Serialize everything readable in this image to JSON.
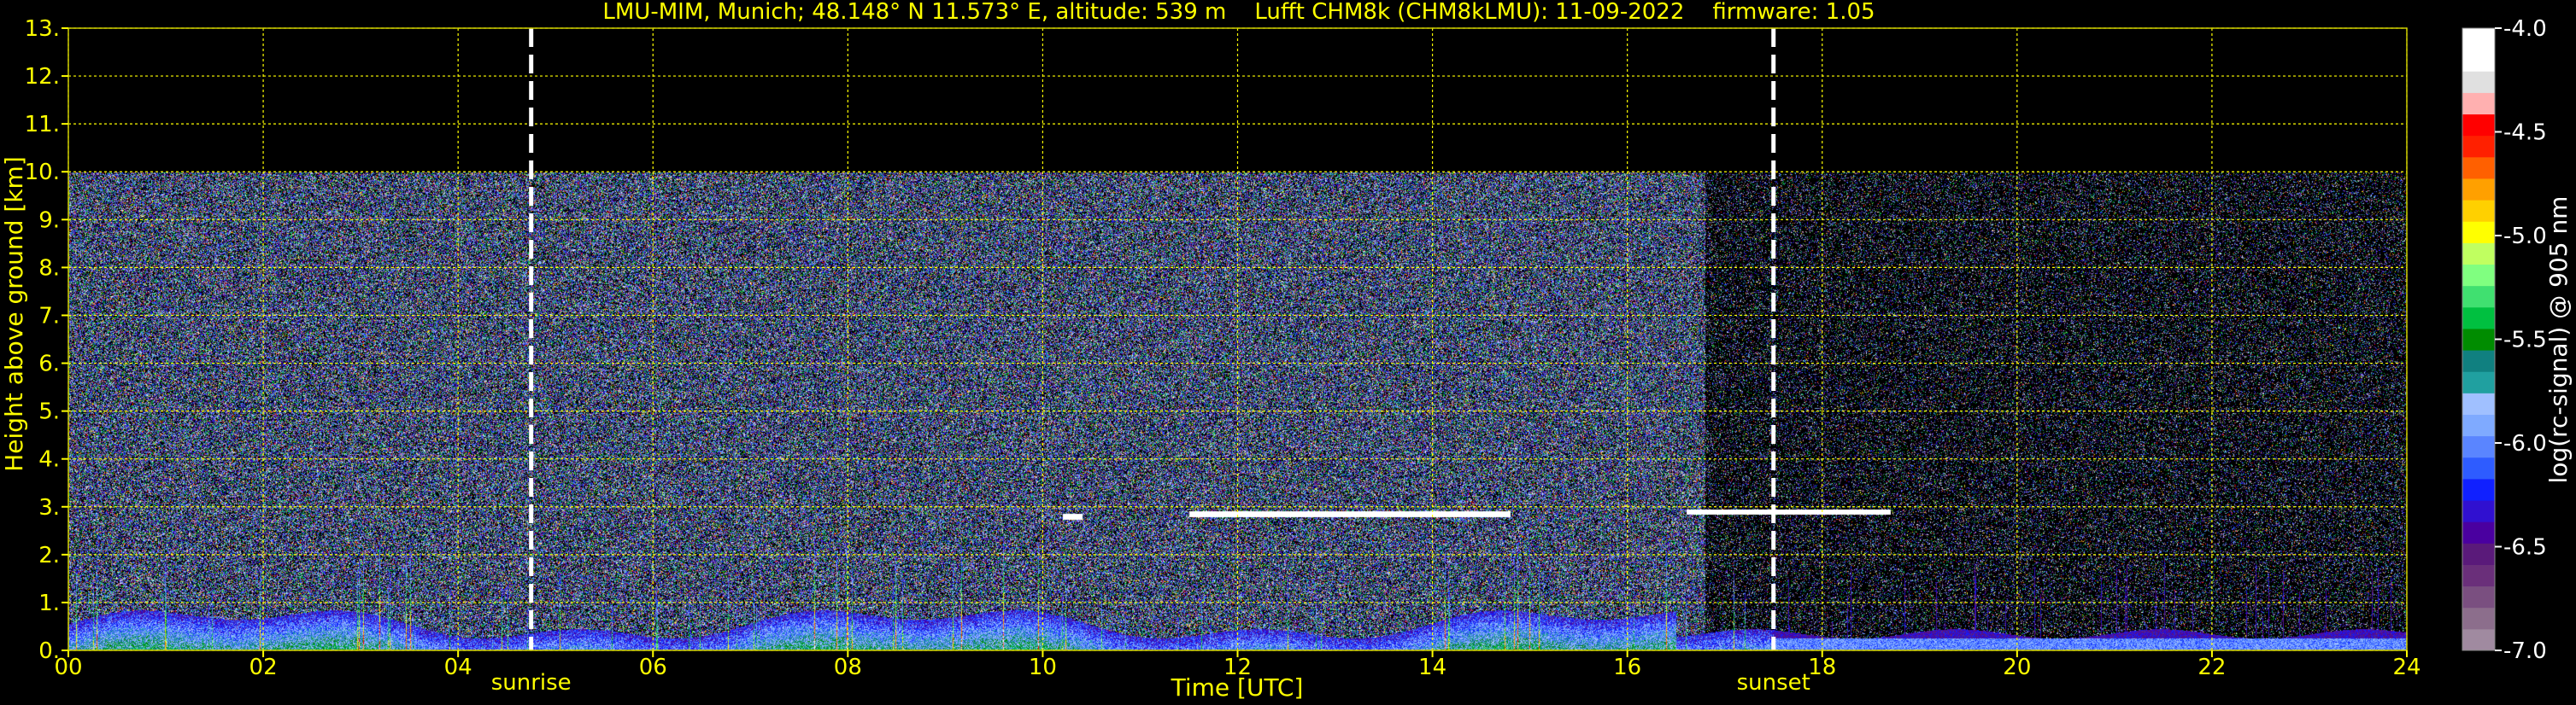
{
  "chart_data": {
    "type": "heatmap",
    "title": "LMU-MIM, Munich; 48.148° N 11.573° E, altitude: 539 m    Lufft CHM8k (CHM8kLMU): 11-09-2022    firmware: 1.05",
    "xlabel": "Time [UTC]",
    "ylabel": "Height above ground [km]",
    "xlim": [
      0,
      24
    ],
    "ylim": [
      0,
      13
    ],
    "x_ticks": [
      "00",
      "02",
      "04",
      "06",
      "08",
      "10",
      "12",
      "14",
      "16",
      "18",
      "20",
      "22",
      "24"
    ],
    "y_ticks": [
      "0.",
      "1.",
      "2.",
      "3.",
      "4.",
      "5.",
      "6.",
      "7.",
      "8.",
      "9.",
      "10.",
      "11.",
      "12.",
      "13."
    ],
    "grid": true,
    "data_top_km": 10,
    "markers": [
      {
        "label": "sunrise",
        "time": 4.75
      },
      {
        "label": "sunset",
        "time": 17.5
      }
    ],
    "colorbar": {
      "label": "log(rc-signal) @ 905 nm",
      "range": [
        -7.0,
        -4.0
      ],
      "ticks": [
        "-4.0",
        "-4.5",
        "-5.0",
        "-5.5",
        "-6.0",
        "-6.5",
        "-7.0"
      ],
      "colors": [
        "#a08aa0",
        "#8c6e8c",
        "#7a4f80",
        "#6a2f7a",
        "#5a1a7a",
        "#4a00a0",
        "#3010d0",
        "#1020ff",
        "#2e5cff",
        "#5a85ff",
        "#7faaff",
        "#a0c0ff",
        "#20a0a0",
        "#108080",
        "#008c00",
        "#00c040",
        "#40e070",
        "#80ff80",
        "#c0ff60",
        "#ffff00",
        "#ffd000",
        "#ffa000",
        "#ff6000",
        "#ff2000",
        "#ff0000",
        "#ffb0b0",
        "#e0e0e0",
        "#ffffff",
        "#ffffff"
      ]
    },
    "features": {
      "cloud_layer_km": [
        {
          "start": 10.2,
          "end": 10.4,
          "height": 2.8
        },
        {
          "start": 11.5,
          "end": 14.8,
          "height": 2.85
        },
        {
          "start": 16.6,
          "end": 18.7,
          "height": 2.9
        }
      ]
    }
  },
  "colors": {
    "axis": "#ffff00",
    "grid": "#ffff00",
    "marker": "#ffffff",
    "background": "#000000"
  }
}
